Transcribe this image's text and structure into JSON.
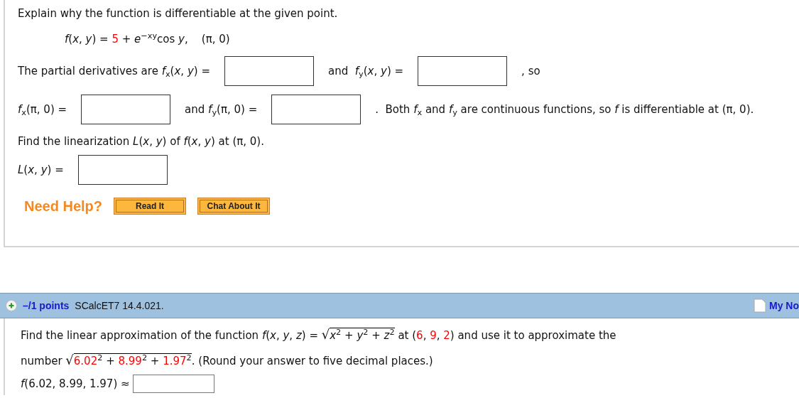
{
  "problem1": {
    "lines": [
      {
        "kind": "intro",
        "items": [
          {
            "kind": "text",
            "parts": [
              {
                "kind": "plain",
                "text": "Explain why the function is differentiable at the given point."
              }
            ]
          }
        ]
      },
      {
        "kind": "formula",
        "items": [
          {
            "kind": "text",
            "parts": [
              {
                "kind": "plain",
                "text": "*f*(*x*, *y*) = "
              },
              {
                "kind": "red",
                "text": "5"
              },
              {
                "kind": "plain",
                "text": " + *e*$^{−xy}$cos *y*,    (π, 0)"
              }
            ]
          }
        ]
      },
      {
        "kind": "answer",
        "items": [
          {
            "kind": "text",
            "parts": [
              {
                "kind": "plain",
                "text": "The partial derivatives are *f*$_{x}$(*x*, *y*) ="
              }
            ]
          },
          {
            "kind": "field"
          },
          {
            "kind": "text",
            "parts": [
              {
                "kind": "plain",
                "text": "and  *f*$_{y}$(*x*, *y*) ="
              }
            ]
          },
          {
            "kind": "field"
          },
          {
            "kind": "text",
            "parts": [
              {
                "kind": "plain",
                "text": ", so"
              }
            ]
          }
        ]
      },
      {
        "kind": "answer",
        "items": [
          {
            "kind": "text",
            "parts": [
              {
                "kind": "plain",
                "text": "*f*$_{x}$(π, 0) ="
              }
            ]
          },
          {
            "kind": "field"
          },
          {
            "kind": "text",
            "parts": [
              {
                "kind": "plain",
                "text": "and *f*$_{y}$(π, 0) ="
              }
            ]
          },
          {
            "kind": "field"
          },
          {
            "kind": "text",
            "parts": [
              {
                "kind": "plain",
                "text": ".  Both *f*$_{x}$ and *f*$_{y}$ are continuous functions, so *f* is differentiable at (π, 0)."
              }
            ]
          }
        ]
      },
      {
        "kind": "intro",
        "items": [
          {
            "kind": "text",
            "parts": [
              {
                "kind": "plain",
                "text": "Find the linearization *L*(*x*, *y*) of *f*(*x*, *y*) at (π, 0)."
              }
            ]
          }
        ]
      },
      {
        "kind": "answer-tight",
        "items": [
          {
            "kind": "text",
            "parts": [
              {
                "kind": "plain",
                "text": "*L*(*x*, *y*) ="
              }
            ]
          },
          {
            "kind": "field"
          }
        ]
      }
    ],
    "help": {
      "label": "Need Help?",
      "buttons": [
        "Read It",
        "Chat About It"
      ]
    }
  },
  "problem2": {
    "header": {
      "points": "–/1 points",
      "code": "SCalcET7 14.4.021.",
      "notes": "My No"
    },
    "lines": [
      {
        "kind": "intro",
        "items": [
          {
            "kind": "text",
            "parts": [
              {
                "kind": "plain",
                "text": "Find the linear approximation of the function *f*(*x*, *y*, *z*) = "
              },
              {
                "kind": "sqrt",
                "sign": "√",
                "parts": [
                  {
                    "kind": "plain",
                    "text": "*x*$^{2}$ + *y*$^{2}$ + *z*$^{2}$"
                  }
                ]
              },
              {
                "kind": "plain",
                "text": " at ("
              },
              {
                "kind": "red",
                "text": "6"
              },
              {
                "kind": "plain",
                "text": ", "
              },
              {
                "kind": "red",
                "text": "9"
              },
              {
                "kind": "plain",
                "text": ", "
              },
              {
                "kind": "red",
                "text": "2"
              },
              {
                "kind": "plain",
                "text": ") and use it to approximate the"
              }
            ]
          }
        ]
      },
      {
        "kind": "intro",
        "items": [
          {
            "kind": "text",
            "parts": [
              {
                "kind": "plain",
                "text": "number "
              },
              {
                "kind": "sqrt",
                "sign": "√",
                "parts": [
                  {
                    "kind": "red",
                    "text": "6.02"
                  },
                  {
                    "kind": "plain",
                    "text": "$^{2}$ + "
                  },
                  {
                    "kind": "red",
                    "text": "8.99"
                  },
                  {
                    "kind": "plain",
                    "text": "$^{2}$ + "
                  },
                  {
                    "kind": "red",
                    "text": "1.97"
                  },
                  {
                    "kind": "plain",
                    "text": "$^{2}$"
                  }
                ]
              },
              {
                "kind": "plain",
                "text": ". (Round your answer to five decimal places.)"
              }
            ]
          }
        ]
      },
      {
        "kind": "answer-small",
        "items": [
          {
            "kind": "text",
            "parts": [
              {
                "kind": "plain",
                "text": "*f*(6.02, 8.99, 1.97) ≈"
              }
            ]
          },
          {
            "kind": "small-field"
          }
        ]
      }
    ]
  }
}
